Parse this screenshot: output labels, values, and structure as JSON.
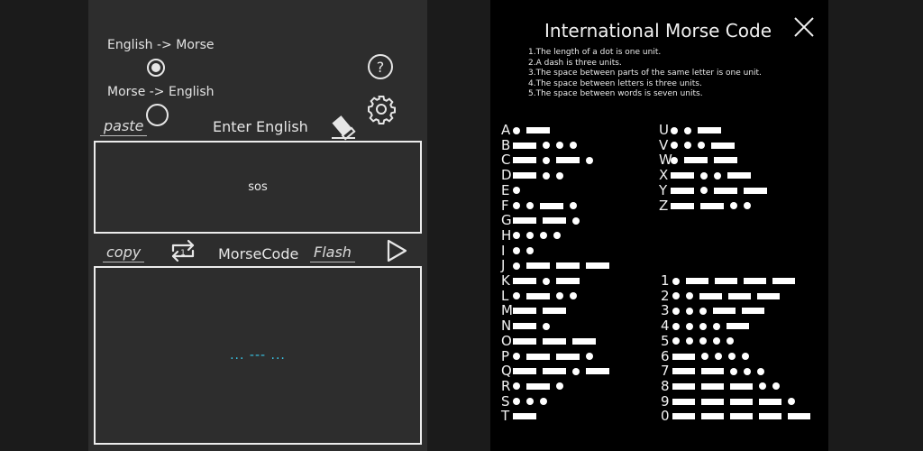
{
  "translator": {
    "mode_options": [
      {
        "label": "English -> Morse",
        "selected": true
      },
      {
        "label": "Morse -> English",
        "selected": false
      }
    ],
    "paste_label": "paste",
    "input_heading": "Enter English",
    "input_text": "sos",
    "copy_label": "copy",
    "output_heading": "MorseCode",
    "flash_label": "Flash",
    "output_text": "... --- ...",
    "help_glyph": "?",
    "icons": [
      "help-icon",
      "settings-gear-icon",
      "eraser-icon",
      "swap-icon",
      "play-icon"
    ],
    "output_color": "#39c6e8"
  },
  "reference": {
    "title": "International Morse Code",
    "rules": [
      "1.The length of a dot is one unit.",
      "2.A dash is three units.",
      "3.The space between parts of the same letter is one unit.",
      "4.The space between letters is three units.",
      "5.The space between words is seven units."
    ],
    "letters": [
      {
        "char": "A",
        "code": ".-"
      },
      {
        "char": "B",
        "code": "-..."
      },
      {
        "char": "C",
        "code": "-.-."
      },
      {
        "char": "D",
        "code": "-.."
      },
      {
        "char": "E",
        "code": "."
      },
      {
        "char": "F",
        "code": "..-."
      },
      {
        "char": "G",
        "code": "--."
      },
      {
        "char": "H",
        "code": "...."
      },
      {
        "char": "I",
        "code": ".."
      },
      {
        "char": "J",
        "code": ".---"
      },
      {
        "char": "K",
        "code": "-.-"
      },
      {
        "char": "L",
        "code": ".-.."
      },
      {
        "char": "M",
        "code": "--"
      },
      {
        "char": "N",
        "code": "-."
      },
      {
        "char": "O",
        "code": "---"
      },
      {
        "char": "P",
        "code": ".--."
      },
      {
        "char": "Q",
        "code": "--.-"
      },
      {
        "char": "R",
        "code": ".-."
      },
      {
        "char": "S",
        "code": "..."
      },
      {
        "char": "T",
        "code": "-"
      }
    ],
    "letters2": [
      {
        "char": "U",
        "code": "..-"
      },
      {
        "char": "V",
        "code": "...-"
      },
      {
        "char": "W",
        "code": ".--"
      },
      {
        "char": "X",
        "code": "-..-"
      },
      {
        "char": "Y",
        "code": "-.--"
      },
      {
        "char": "Z",
        "code": "--.."
      }
    ],
    "digits": [
      {
        "char": "1",
        "code": ".----"
      },
      {
        "char": "2",
        "code": "..---"
      },
      {
        "char": "3",
        "code": "...--"
      },
      {
        "char": "4",
        "code": "....-"
      },
      {
        "char": "5",
        "code": "....."
      },
      {
        "char": "6",
        "code": "-...."
      },
      {
        "char": "7",
        "code": "--..."
      },
      {
        "char": "8",
        "code": "---.."
      },
      {
        "char": "9",
        "code": "----."
      },
      {
        "char": "0",
        "code": "-----"
      }
    ],
    "close_icon": "close-icon"
  }
}
